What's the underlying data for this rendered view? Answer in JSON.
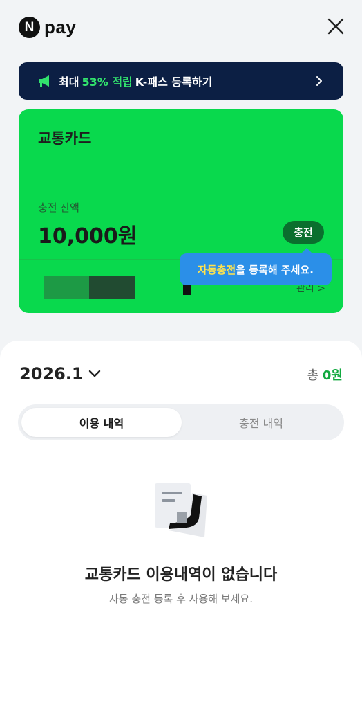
{
  "header": {
    "logo_letter": "N",
    "logo_text": "pay",
    "close_icon": "close-icon"
  },
  "banner": {
    "text_prefix": "최대",
    "text_accent": "53% 적립",
    "text_suffix": "K-패스 등록하기",
    "icon": "megaphone-icon",
    "accent_color": "#32e36d",
    "background": "#0c1f44"
  },
  "card": {
    "title": "교통카드",
    "balance_label": "충전 잔액",
    "balance": "10,000원",
    "charge_button": "충전",
    "link_text": "관리 >",
    "color": "#09d94d"
  },
  "tooltip": {
    "highlight": "자동충전",
    "text": "을 등록해 주세요."
  },
  "history": {
    "month": "2026.1",
    "total_label": "총",
    "total_value": "0원",
    "tabs": [
      {
        "label": "이용 내역",
        "active": true
      },
      {
        "label": "충전 내역",
        "active": false
      }
    ],
    "empty_title": "교통카드 이용내역이 없습니다",
    "empty_subtitle": "자동 충전 등록 후 사용해 보세요."
  }
}
